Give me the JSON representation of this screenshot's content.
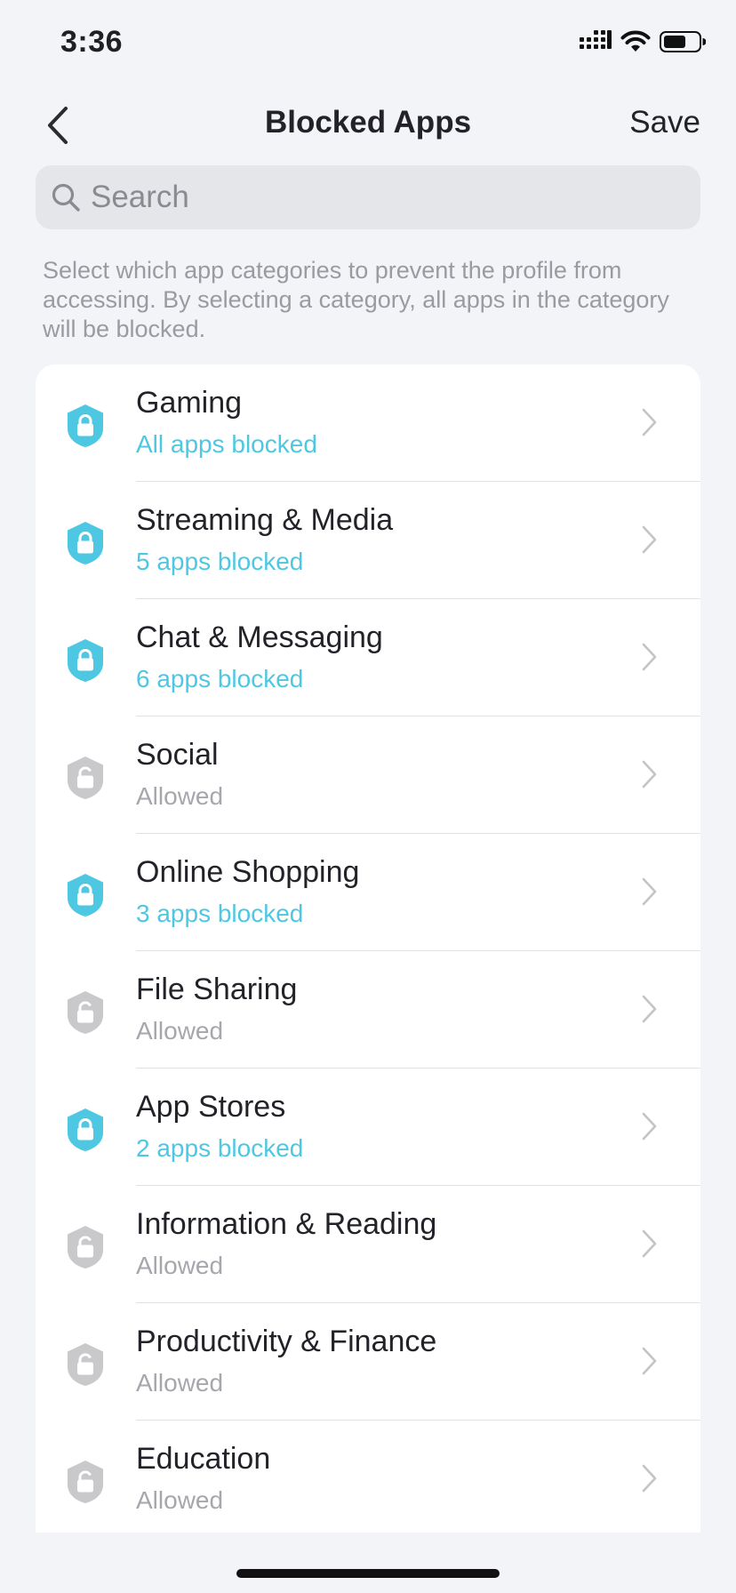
{
  "status_bar": {
    "time": "3:36"
  },
  "nav": {
    "title": "Blocked Apps",
    "save_label": "Save"
  },
  "search": {
    "placeholder": "Search",
    "value": ""
  },
  "description": "Select which app categories to prevent the profile from accessing. By selecting a category, all apps in the category will be blocked.",
  "colors": {
    "blocked": "#4ec8e2",
    "allowed_icon": "#c9c9cc",
    "allowed_text": "#a6a7ac"
  },
  "categories": [
    {
      "title": "Gaming",
      "status": "All apps blocked",
      "state": "blocked",
      "icon": "lock-shield-icon"
    },
    {
      "title": "Streaming & Media",
      "status": "5 apps blocked",
      "state": "blocked",
      "icon": "lock-shield-icon"
    },
    {
      "title": "Chat & Messaging",
      "status": "6 apps blocked",
      "state": "blocked",
      "icon": "lock-shield-icon"
    },
    {
      "title": "Social",
      "status": "Allowed",
      "state": "allowed",
      "icon": "unlock-shield-icon"
    },
    {
      "title": "Online Shopping",
      "status": "3 apps blocked",
      "state": "blocked",
      "icon": "lock-shield-icon"
    },
    {
      "title": "File Sharing",
      "status": "Allowed",
      "state": "allowed",
      "icon": "unlock-shield-icon"
    },
    {
      "title": "App Stores",
      "status": "2 apps blocked",
      "state": "blocked",
      "icon": "lock-shield-icon"
    },
    {
      "title": "Information & Reading",
      "status": "Allowed",
      "state": "allowed",
      "icon": "unlock-shield-icon"
    },
    {
      "title": "Productivity & Finance",
      "status": "Allowed",
      "state": "allowed",
      "icon": "unlock-shield-icon"
    },
    {
      "title": "Education",
      "status": "Allowed",
      "state": "allowed",
      "icon": "unlock-shield-icon"
    }
  ]
}
